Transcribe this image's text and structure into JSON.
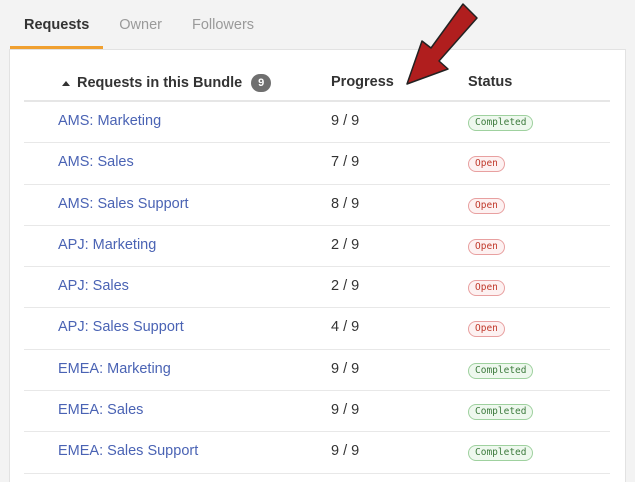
{
  "tabs": [
    {
      "label": "Requests",
      "active": true
    },
    {
      "label": "Owner",
      "active": false
    },
    {
      "label": "Followers",
      "active": false
    }
  ],
  "table": {
    "headers": {
      "requests": "Requests in this Bundle",
      "requests_count": "9",
      "progress": "Progress",
      "status": "Status"
    },
    "sort_icon": "caret-up-icon",
    "rows": [
      {
        "name": "AMS: Marketing",
        "progress": "9 / 9",
        "status": "Completed"
      },
      {
        "name": "AMS: Sales",
        "progress": "7 / 9",
        "status": "Open"
      },
      {
        "name": "AMS: Sales Support",
        "progress": "8 / 9",
        "status": "Open"
      },
      {
        "name": "APJ: Marketing",
        "progress": "2 / 9",
        "status": "Open"
      },
      {
        "name": "APJ: Sales",
        "progress": "2 / 9",
        "status": "Open"
      },
      {
        "name": "APJ: Sales Support",
        "progress": "4 / 9",
        "status": "Open"
      },
      {
        "name": "EMEA: Marketing",
        "progress": "9 / 9",
        "status": "Completed"
      },
      {
        "name": "EMEA: Sales",
        "progress": "9 / 9",
        "status": "Completed"
      },
      {
        "name": "EMEA: Sales Support",
        "progress": "9 / 9",
        "status": "Completed"
      }
    ]
  },
  "annotation": {
    "icon": "red-arrow-icon",
    "color": "#b01e1e"
  },
  "colors": {
    "accent_tab": "#f0a030",
    "link": "#4a63b4",
    "completed": "#3c7a3c",
    "open": "#c0392b"
  }
}
